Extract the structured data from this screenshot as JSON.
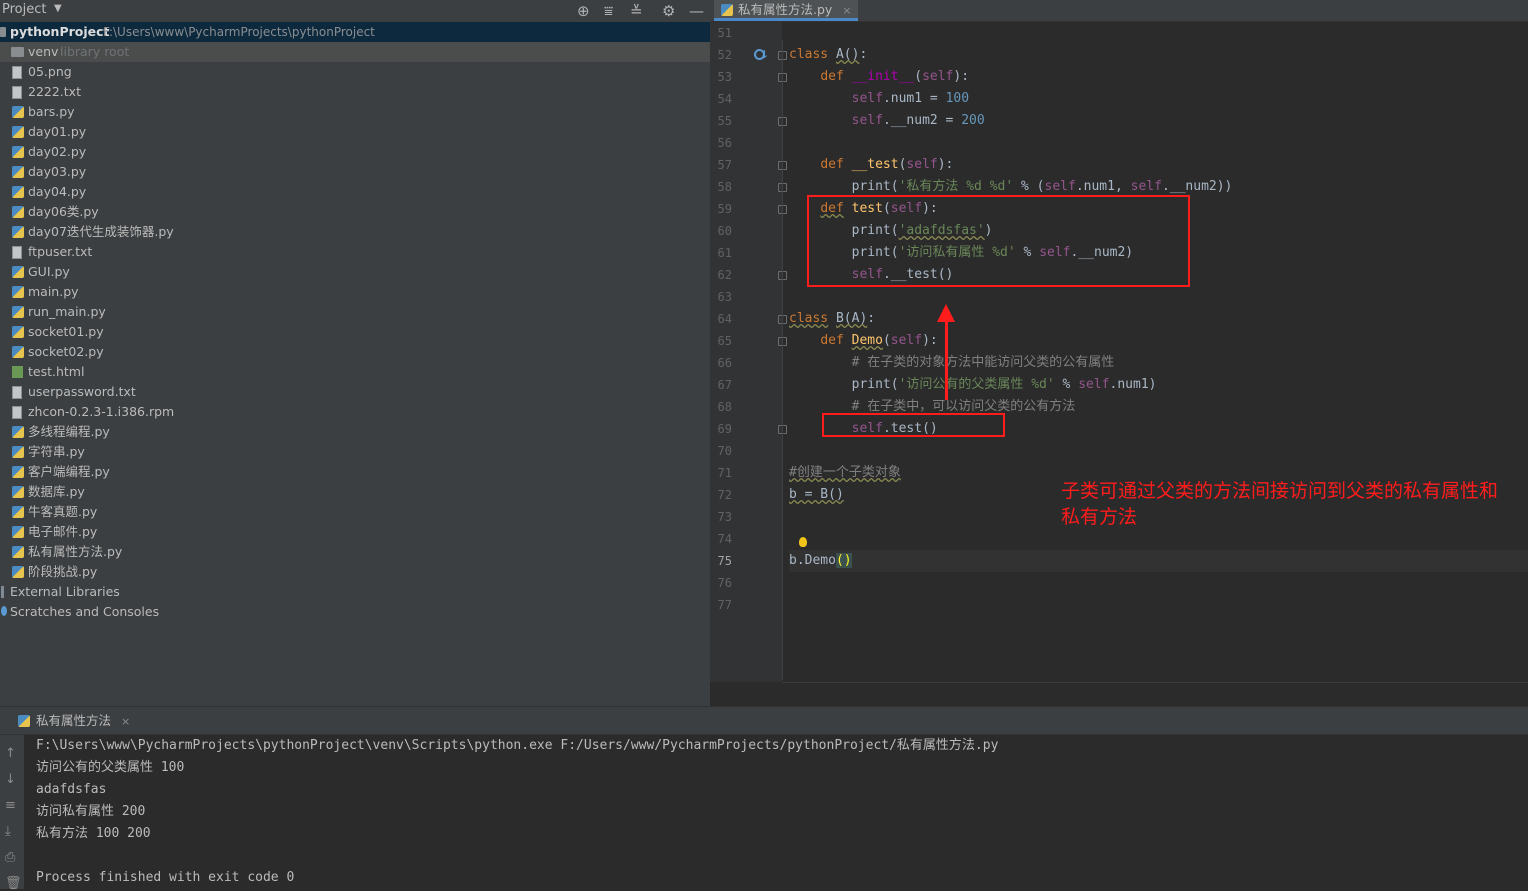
{
  "project_panel": {
    "title": "Project",
    "root_name": "pythonProject",
    "root_path": "F:\\Users\\www\\PycharmProjects\\pythonProject",
    "venv_name": "venv",
    "venv_note": "library root",
    "files": [
      "05.png",
      "2222.txt",
      "bars.py",
      "day01.py",
      "day02.py",
      "day03.py",
      "day04.py",
      "day06类.py",
      "day07迭代生成装饰器.py",
      "ftpuser.txt",
      "GUI.py",
      "main.py",
      "run_main.py",
      "socket01.py",
      "socket02.py",
      "test.html",
      "userpassword.txt",
      "zhcon-0.2.3-1.i386.rpm",
      "多线程编程.py",
      "字符串.py",
      "客户端编程.py",
      "数据库.py",
      "牛客真题.py",
      "电子邮件.py",
      "私有属性方法.py",
      "阶段挑战.py"
    ],
    "external_libraries": "External Libraries",
    "scratches": "Scratches and Consoles",
    "icons": [
      "locate-icon",
      "expand-all-icon",
      "collapse-all-icon",
      "gear-icon",
      "minimize-icon"
    ]
  },
  "editor": {
    "tab_label": "私有属性方法.py",
    "tab_close": "×",
    "line_numbers": [
      "51",
      "52",
      "53",
      "54",
      "55",
      "56",
      "57",
      "58",
      "59",
      "60",
      "61",
      "62",
      "63",
      "64",
      "65",
      "66",
      "67",
      "68",
      "69",
      "70",
      "71",
      "72",
      "73",
      "74",
      "75",
      "76",
      "77"
    ],
    "current_line": "75",
    "annotation": "子类可通过父类的方法间接访问到父类的私有属性和私有方法"
  },
  "run_panel": {
    "tab_label": "私有属性方法",
    "tab_close": "×",
    "output": [
      "F:\\Users\\www\\PycharmProjects\\pythonProject\\venv\\Scripts\\python.exe F:/Users/www/PycharmProjects/pythonProject/私有属性方法.py",
      "访问公有的父类属性 100",
      "adafdsfas",
      "访问私有属性 200",
      "私有方法 100 200",
      "",
      "Process finished with exit code 0"
    ]
  }
}
